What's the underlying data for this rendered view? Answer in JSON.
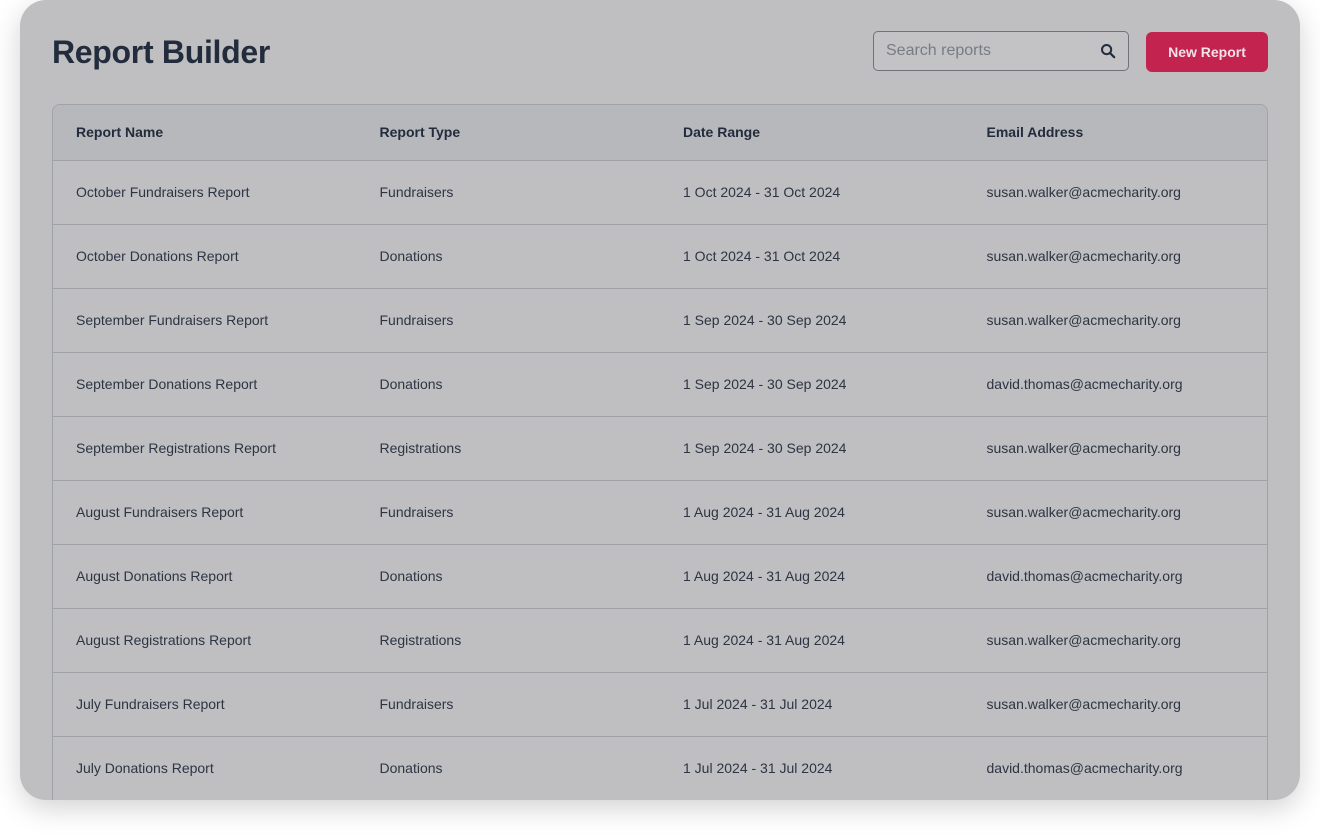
{
  "header": {
    "title": "Report Builder",
    "search_placeholder": "Search reports",
    "search_value": "",
    "new_report_label": "New Report"
  },
  "icons": {
    "search": "search-icon"
  },
  "colors": {
    "accent": "#c2244f",
    "title": "#222c3c"
  },
  "table": {
    "columns": [
      "Report Name",
      "Report Type",
      "Date Range",
      "Email Address"
    ],
    "rows": [
      [
        "October Fundraisers Report",
        "Fundraisers",
        "1 Oct 2024 - 31 Oct 2024",
        "susan.walker@acmecharity.org"
      ],
      [
        "October Donations Report",
        "Donations",
        "1 Oct 2024 - 31 Oct 2024",
        "susan.walker@acmecharity.org"
      ],
      [
        "September Fundraisers Report",
        "Fundraisers",
        "1 Sep 2024 - 30 Sep 2024",
        "susan.walker@acmecharity.org"
      ],
      [
        "September Donations Report",
        "Donations",
        "1 Sep 2024 - 30 Sep 2024",
        "david.thomas@acmecharity.org"
      ],
      [
        "September Registrations Report",
        "Registrations",
        "1 Sep 2024 - 30 Sep 2024",
        "susan.walker@acmecharity.org"
      ],
      [
        "August Fundraisers Report",
        "Fundraisers",
        "1 Aug 2024 - 31 Aug 2024",
        "susan.walker@acmecharity.org"
      ],
      [
        "August Donations Report",
        "Donations",
        "1 Aug 2024 - 31 Aug 2024",
        "david.thomas@acmecharity.org"
      ],
      [
        "August Registrations Report",
        "Registrations",
        "1 Aug 2024 - 31 Aug 2024",
        "susan.walker@acmecharity.org"
      ],
      [
        "July Fundraisers Report",
        "Fundraisers",
        "1 Jul 2024 - 31 Jul 2024",
        "susan.walker@acmecharity.org"
      ],
      [
        "July Donations Report",
        "Donations",
        "1 Jul 2024 - 31 Jul 2024",
        "david.thomas@acmecharity.org"
      ]
    ]
  }
}
